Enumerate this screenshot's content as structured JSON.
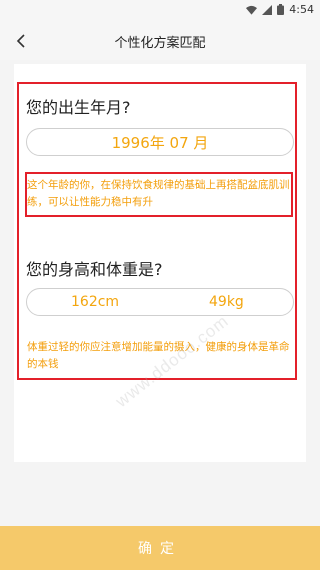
{
  "status_bar": {
    "time": "4:54",
    "icons": [
      "wifi-icon",
      "signal-icon",
      "battery-icon"
    ]
  },
  "nav": {
    "title": "个性化方案匹配",
    "back_icon": "chevron-left-icon"
  },
  "birth": {
    "question": "您的出生年月?",
    "value": "1996年 07 月",
    "tip": "这个年龄的你，在保持饮食规律的基础上再搭配盆底肌训练，可以让性能力稳中有升"
  },
  "body": {
    "question": "您的身高和体重是?",
    "height": "162cm",
    "weight": "49kg",
    "tip": "体重过轻的你应注意增加能量的摄入，健康的身体是革命的本钱"
  },
  "watermark": "www.ddooo.com",
  "confirm_label": "确定",
  "colors": {
    "accent": "#f3a60f",
    "button": "#f5c96a",
    "highlight_border": "#e3202a"
  }
}
